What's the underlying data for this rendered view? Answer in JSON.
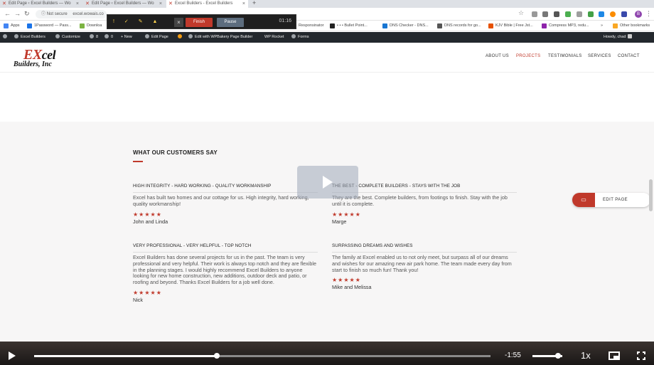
{
  "browser": {
    "tabs": [
      {
        "label": "Edit Page ‹ Excel Builders — Wo",
        "active": false
      },
      {
        "label": "Edit Page ‹ Excel Builders — Wo",
        "active": false
      },
      {
        "label": "Excel Builders - Excel Builders",
        "active": true
      }
    ],
    "new_tab": "+",
    "url_prefix": "Not secure",
    "url": "excel.wowais.co",
    "profile_initial": "B"
  },
  "bookmarks": [
    {
      "label": "Apps",
      "color": "#4285f4"
    },
    {
      "label": "1Password — Pass...",
      "color": "#1a73e8"
    },
    {
      "label": "Downloa",
      "color": "#7cb342"
    },
    {
      "label": "Responsinator",
      "color": "#999999"
    },
    {
      "label": "• • • Bullet Point...",
      "color": "#222222"
    },
    {
      "label": "DNS Checker - DNS...",
      "color": "#1976d2"
    },
    {
      "label": "DNS records for go...",
      "color": "#555555"
    },
    {
      "label": "KJV Bible | Free Jst...",
      "color": "#e65100"
    },
    {
      "label": "Compress MP3, redu...",
      "color": "#8e24aa"
    },
    {
      "label": "Other bookmarks",
      "color": "#f9a825"
    }
  ],
  "recorder": {
    "finish": "Finish",
    "pause": "Pause",
    "close": "×",
    "time": "01:16",
    "icons": "! ✓ ✎ ▲"
  },
  "adminbar": {
    "site": "Excel Builders",
    "customize": "Customize",
    "updates": "8",
    "comments": "0",
    "new": "+ New",
    "edit_page": "Edit Page",
    "wpbakery": "Edit with WPBakery Page Builder",
    "wprocket": "WP Rocket",
    "forms": "Forms",
    "howdy": "Howdy, chad"
  },
  "site": {
    "logo_top": "Excel",
    "logo_bottom": "Builders, Inc",
    "nav": [
      "ABOUT US",
      "PROJECTS",
      "TESTIMONIALS",
      "SERVICES",
      "CONTACT"
    ],
    "nav_active": "PROJECTS"
  },
  "section": {
    "title": "WHAT OUR CUSTOMERS SAY"
  },
  "testimonials": [
    {
      "head": "HIGH INTEGRITY - HARD WORKING - QUALITY WORKMANSHIP",
      "body": "Excel has built two homes and our cottage for us. High integrity, hard working, quality workmanship!",
      "stars": "★★★★★",
      "rating": 5,
      "author": "John and Linda"
    },
    {
      "head": "THE BEST - COMPLETE BUILDERS - STAYS WITH THE JOB",
      "body": "They are the best. Complete builders, from footings to finish. Stay with the job until it is complete.",
      "stars": "★★★★★",
      "rating": 5,
      "author": "Marge"
    },
    {
      "head": "VERY PROFESSIONAL - VERY HELPFUL - TOP NOTCH",
      "body": "Excel Builders has done several projects for us in the past. The team is very professional and very helpful. Their work is always top notch and they are flexible in the planning stages. I would highly recommend Excel Builders to anyone looking for new home construction, new additions, outdoor deck and patio, or roofing and beyond. Thanks Excel Builders for a job well done.",
      "stars": "★★★★★",
      "rating": 5,
      "author": "Nick"
    },
    {
      "head": "SURPASSING DREAMS AND WISHES",
      "body": "The family at Excel enabled us to not only meet, but surpass all of our dreams and wishes for our amazing new air park home. The team made every day from start to finish so much fun! Thank you!",
      "stars": "★★★★★",
      "rating": 5,
      "author": "Mike and Melissa"
    }
  ],
  "edit_page_button": "EDIT PAGE",
  "video": {
    "time_remaining": "-1:55",
    "speed": "1x",
    "progress": 0.4,
    "volume": 0.85
  }
}
